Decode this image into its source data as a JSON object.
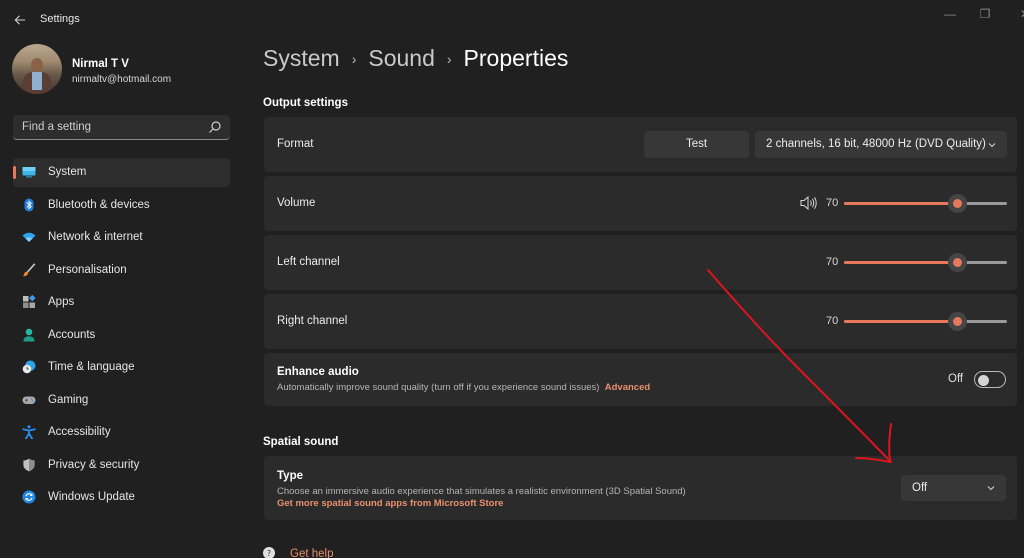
{
  "window": {
    "title": "Settings",
    "controls": {
      "minimize": "—",
      "maximize": "❐",
      "close": "✕"
    }
  },
  "profile": {
    "name": "Nirmal T V",
    "email": "nirmaltv@hotmail.com"
  },
  "search": {
    "placeholder": "Find a setting"
  },
  "sidebar": {
    "items": [
      {
        "label": "System",
        "icon": "monitor-icon",
        "active": true
      },
      {
        "label": "Bluetooth & devices",
        "icon": "bluetooth-icon",
        "active": false
      },
      {
        "label": "Network & internet",
        "icon": "wifi-icon",
        "active": false
      },
      {
        "label": "Personalisation",
        "icon": "brush-icon",
        "active": false
      },
      {
        "label": "Apps",
        "icon": "apps-icon",
        "active": false
      },
      {
        "label": "Accounts",
        "icon": "person-icon",
        "active": false
      },
      {
        "label": "Time & language",
        "icon": "clock-globe-icon",
        "active": false
      },
      {
        "label": "Gaming",
        "icon": "gamepad-icon",
        "active": false
      },
      {
        "label": "Accessibility",
        "icon": "accessibility-icon",
        "active": false
      },
      {
        "label": "Privacy & security",
        "icon": "shield-icon",
        "active": false
      },
      {
        "label": "Windows Update",
        "icon": "update-icon",
        "active": false
      }
    ]
  },
  "breadcrumb": {
    "items": [
      "System",
      "Sound",
      "Properties"
    ],
    "separator": "›"
  },
  "output_settings": {
    "title": "Output settings",
    "format": {
      "label": "Format",
      "test_button": "Test",
      "selected": "2 channels, 16 bit, 48000 Hz (DVD Quality)"
    },
    "volume": {
      "label": "Volume",
      "value": 70,
      "value_text": "70"
    },
    "left_channel": {
      "label": "Left channel",
      "value": 70,
      "value_text": "70"
    },
    "right_channel": {
      "label": "Right channel",
      "value": 70,
      "value_text": "70"
    },
    "enhance_audio": {
      "title": "Enhance audio",
      "description": "Automatically improve sound quality (turn off if you experience sound issues)",
      "link": "Advanced",
      "state_label": "Off",
      "enabled": false
    }
  },
  "spatial_sound": {
    "title": "Spatial sound",
    "type": {
      "title": "Type",
      "description": "Choose an immersive audio experience that simulates a realistic environment (3D Spatial Sound)",
      "link": "Get more spatial sound apps from Microsoft Store",
      "selected": "Off"
    }
  },
  "help": {
    "label": "Get help"
  },
  "colors": {
    "accent": "#e8785c",
    "link": "#e8906e",
    "background": "#202020",
    "card": "#2b2b2b",
    "annotation": "#e0141e"
  }
}
